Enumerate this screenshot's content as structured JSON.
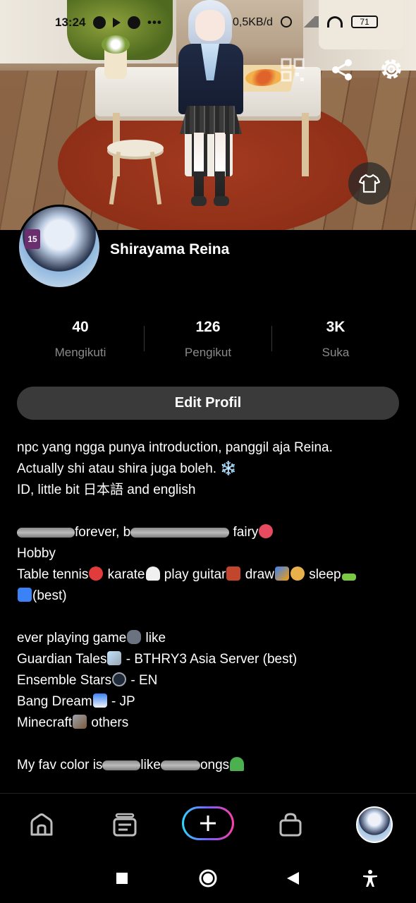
{
  "status_bar": {
    "time": "13:24",
    "net_speed": "0,5KB/d",
    "battery": "71",
    "more": "•••"
  },
  "hero": {
    "qr_icon": "qr-code-icon",
    "share_icon": "share-icon",
    "settings_icon": "gear-icon",
    "outfit_icon": "tshirt-icon",
    "avatar_badge": "15"
  },
  "profile": {
    "username": "Shirayama Reina",
    "stats": [
      {
        "value": "40",
        "label": "Mengikuti"
      },
      {
        "value": "126",
        "label": "Pengikut"
      },
      {
        "value": "3K",
        "label": "Suka"
      }
    ],
    "edit_button": "Edit Profil"
  },
  "bio": {
    "line1": "npc yang ngga punya introduction, panggil aja Reina.",
    "line2": "Actually shi atau shira juga boleh. ❄️",
    "line3": "ID, little bit 日本語 and english",
    "line4a": "forever, b",
    "line4b": " fairy",
    "line5": "Hobby",
    "line6a": "Table tennis",
    "line6b": " karate",
    "line6c": " play guitar",
    "line6d": " draw",
    "line6e": " sleep",
    "line7": "(best)",
    "line8a": "ever playing game",
    "line8b": " like",
    "line9a": "Guardian Tales",
    "line9b": " - BTHRY3 Asia Server (best)",
    "line10a": "Ensemble Stars",
    "line10b": " - EN",
    "line11a": "Bang Dream",
    "line11b": " - JP",
    "line12a": "Minecraft",
    "line12b": " others",
    "line13a": "My fav color is",
    "line13b": "like",
    "line13c": "ongs"
  },
  "bottom_nav": {
    "items": [
      "home-icon",
      "feed-icon",
      "create-plus-icon",
      "shop-bag-icon",
      "profile-avatar"
    ]
  },
  "system_nav": {
    "items": [
      "recents-square-icon",
      "home-circle-icon",
      "back-triangle-icon",
      "accessibility-icon"
    ]
  }
}
